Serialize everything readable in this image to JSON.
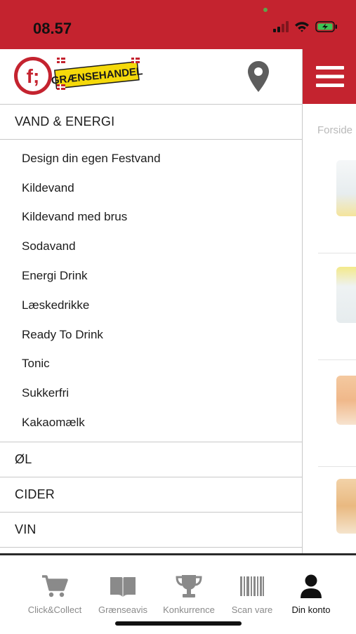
{
  "status": {
    "time": "08.57"
  },
  "header": {
    "logo_letter": "f;",
    "logo_text": "GRÆNSEHANDEL"
  },
  "main": {
    "breadcrumb": "Forside"
  },
  "drawer": {
    "active_category": "VAND & ENERGI",
    "subcategories": [
      "Design din egen Festvand",
      "Kildevand",
      "Kildevand med brus",
      "Sodavand",
      "Energi Drink",
      "Læskedrikke",
      "Ready To Drink",
      "Tonic",
      "Sukkerfri",
      "Kakaomælk"
    ],
    "categories": [
      "ØL",
      "CIDER",
      "VIN"
    ]
  },
  "tabbar": {
    "items": [
      {
        "label": "Click&Collect",
        "icon": "cart-icon",
        "active": false
      },
      {
        "label": "Grænseavis",
        "icon": "book-icon",
        "active": false
      },
      {
        "label": "Konkurrence",
        "icon": "trophy-icon",
        "active": false
      },
      {
        "label": "Scan vare",
        "icon": "barcode-icon",
        "active": false
      },
      {
        "label": "Din konto",
        "icon": "person-icon",
        "active": true
      }
    ]
  },
  "colors": {
    "brand_red": "#c4232f",
    "logo_yellow": "#f5d90a"
  }
}
